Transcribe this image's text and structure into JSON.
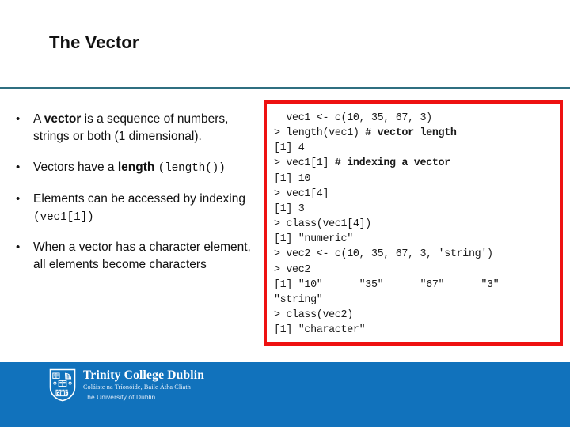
{
  "slide": {
    "title": "The Vector"
  },
  "bullets": [
    {
      "marker": "•",
      "parts": [
        {
          "text": "A ",
          "style": "normal"
        },
        {
          "text": "vector",
          "style": "bold"
        },
        {
          "text": " is a sequence of numbers, strings or both (1 dimensional).",
          "style": "normal"
        }
      ]
    },
    {
      "marker": "•",
      "parts": [
        {
          "text": "Vectors have a ",
          "style": "normal"
        },
        {
          "text": "length",
          "style": "bold"
        },
        {
          "text": " ",
          "style": "normal"
        },
        {
          "text": "(length())",
          "style": "code"
        }
      ]
    },
    {
      "marker": "•",
      "parts": [
        {
          "text": "Elements can be accessed by indexing ",
          "style": "normal"
        },
        {
          "text": "(vec1[1])",
          "style": "code"
        }
      ]
    },
    {
      "marker": "•",
      "parts": [
        {
          "text": "When a vector has a character element, all elements become characters",
          "style": "normal"
        }
      ]
    }
  ],
  "code_panel": {
    "border_color": "#ee1111",
    "lines": [
      [
        {
          "text": "  vec1 <- c(10, 35, 67, 3)",
          "style": "normal"
        }
      ],
      [
        {
          "text": "> length(vec1) ",
          "style": "normal"
        },
        {
          "text": "# vector length",
          "style": "bold"
        }
      ],
      [
        {
          "text": "[1] 4",
          "style": "normal"
        }
      ],
      [
        {
          "text": "> vec1[1] ",
          "style": "normal"
        },
        {
          "text": "# indexing a vector",
          "style": "bold"
        }
      ],
      [
        {
          "text": "[1] 10",
          "style": "normal"
        }
      ],
      [
        {
          "text": "> vec1[4]",
          "style": "normal"
        }
      ],
      [
        {
          "text": "[1] 3",
          "style": "normal"
        }
      ],
      [
        {
          "text": "> class(vec1[4])",
          "style": "normal"
        }
      ],
      [
        {
          "text": "[1] \"numeric\"",
          "style": "normal"
        }
      ],
      [
        {
          "text": "> vec2 <- c(10, 35, 67, 3, 'string')",
          "style": "normal"
        }
      ],
      [
        {
          "text": "> vec2",
          "style": "normal"
        }
      ],
      [
        {
          "text": "[1] \"10\"      \"35\"      \"67\"      \"3\"",
          "style": "normal"
        }
      ],
      [
        {
          "text": "\"string\"",
          "style": "normal"
        }
      ],
      [
        {
          "text": "> class(vec2)",
          "style": "normal"
        }
      ],
      [
        {
          "text": "[1] \"character\"",
          "style": "normal"
        }
      ]
    ]
  },
  "footer": {
    "background_color": "#1172bc",
    "logo": {
      "name": "Trinity College Dublin",
      "irish_name": "Coláiste na Tríonóide, Baile Átha Cliath",
      "subtitle": "The University of Dublin"
    }
  },
  "divider": {
    "color": "#2f6f81"
  }
}
